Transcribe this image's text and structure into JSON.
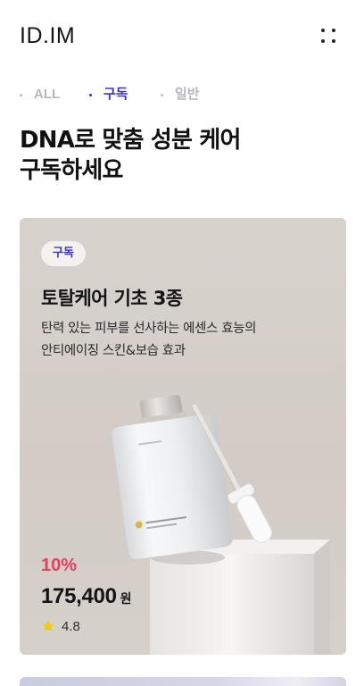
{
  "header": {
    "logo": "ID.IM",
    "menu_icon": "more-dots-icon"
  },
  "tabs": [
    {
      "label": "ALL",
      "active": false
    },
    {
      "label": "구독",
      "active": true
    },
    {
      "label": "일반",
      "active": false
    }
  ],
  "page_title": {
    "line1": "DNA로 맞춤 성분 케어",
    "line2": "구독하세요"
  },
  "product_card": {
    "badge": "구독",
    "name": "토탈케어 기초 3종",
    "description_line1": "탄력 있는 피부를 선사하는 에센스 효능의",
    "description_line2": "안티에이징 스킨&보습 효과",
    "discount": "10%",
    "price": "175,400",
    "currency": "원",
    "rating": "4.8",
    "rating_icon": "star-icon",
    "colors": {
      "discount": "#e5405e",
      "accent": "#3a35b8",
      "star": "#f5c518"
    }
  }
}
